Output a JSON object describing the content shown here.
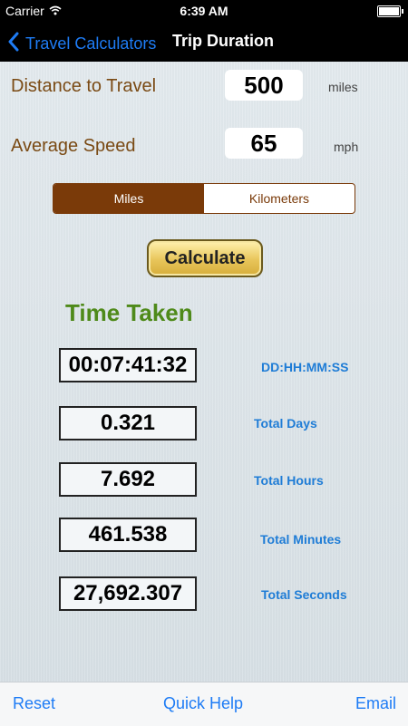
{
  "status_bar": {
    "carrier": "Carrier",
    "time": "6:39 AM"
  },
  "nav": {
    "back_label": "Travel Calculators",
    "title": "Trip Duration"
  },
  "form": {
    "distance": {
      "label": "Distance to Travel",
      "value": "500",
      "unit": "miles"
    },
    "speed": {
      "label": "Average Speed",
      "value": "65",
      "unit": "mph"
    }
  },
  "units_toggle": {
    "options": [
      "Miles",
      "Kilometers"
    ],
    "selected": "Miles"
  },
  "calculate_label": "Calculate",
  "results": {
    "title": "Time Taken",
    "rows": [
      {
        "value": "00:07:41:32",
        "label": "DD:HH:MM:SS"
      },
      {
        "value": "0.321",
        "label": "Total Days"
      },
      {
        "value": "7.692",
        "label": "Total Hours"
      },
      {
        "value": "461.538",
        "label": "Total Minutes"
      },
      {
        "value": "27,692.307",
        "label": "Total Seconds"
      }
    ]
  },
  "toolbar": {
    "reset": "Reset",
    "help": "Quick Help",
    "email": "Email"
  },
  "colors": {
    "accent": "#1e7cf5",
    "brown": "#7a3a09",
    "green_title": "#4f8a1a"
  }
}
